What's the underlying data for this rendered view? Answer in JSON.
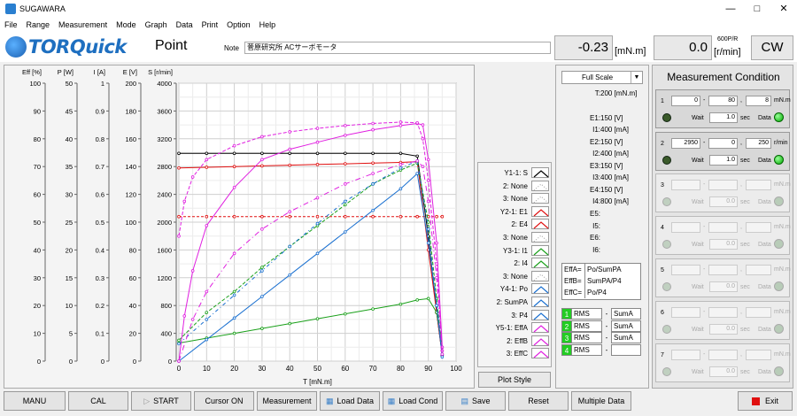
{
  "window": {
    "title": "SUGAWARA"
  },
  "menu": [
    "File",
    "Range",
    "Measurement",
    "Mode",
    "Graph",
    "Data",
    "Print",
    "Option",
    "Help"
  ],
  "header": {
    "logo_text": "TORQuick",
    "mode": "Point",
    "note_label": "Note",
    "note_value": "菅原研究所 ACサーボモータ",
    "torque_value": "-0.23",
    "torque_unit": "[mN.m]",
    "speed_value": "0.0",
    "speed_ppr": "600P/R",
    "speed_unit": "[r/min]",
    "direction": "CW"
  },
  "axes": {
    "labels": [
      "Eff [%]",
      "P [W]",
      "I [A]",
      "E [V]",
      "S [r/min]"
    ],
    "eff": [
      "100",
      "90",
      "80",
      "70",
      "60",
      "50",
      "40",
      "30",
      "20",
      "10",
      "0"
    ],
    "p": [
      "50",
      "45",
      "40",
      "35",
      "30",
      "25",
      "20",
      "15",
      "10",
      "5",
      "0"
    ],
    "i": [
      "1",
      "0.9",
      "0.8",
      "0.7",
      "0.6",
      "0.5",
      "0.4",
      "0.3",
      "0.2",
      "0.1",
      "0"
    ],
    "e": [
      "200",
      "180",
      "160",
      "140",
      "120",
      "100",
      "80",
      "60",
      "40",
      "20",
      "0"
    ],
    "s": [
      "4000",
      "3600",
      "3200",
      "2800",
      "2400",
      "2000",
      "1600",
      "1200",
      "800",
      "400",
      "0"
    ],
    "x": [
      "0",
      "10",
      "20",
      "30",
      "40",
      "50",
      "60",
      "70",
      "80",
      "90",
      "100"
    ],
    "x_label": "T [mN.m]"
  },
  "chart_data": {
    "type": "line",
    "x_label": "T [mN.m]",
    "xlim": [
      0,
      100
    ],
    "ylim_speed": [
      0,
      4000
    ],
    "grid": true,
    "series": [
      {
        "name": "Y1-1: S",
        "color": "#000000",
        "x": [
          0,
          10,
          20,
          30,
          40,
          50,
          60,
          70,
          80,
          86,
          90,
          93,
          95
        ],
        "y": [
          2990,
          2990,
          2990,
          2990,
          2990,
          2990,
          2990,
          2990,
          2990,
          2950,
          1800,
          700,
          80
        ]
      },
      {
        "name": "Y2-1: E1",
        "color": "#e01010",
        "x": [
          0,
          10,
          20,
          30,
          40,
          50,
          60,
          70,
          80,
          86,
          90,
          93,
          95
        ],
        "y": [
          2780,
          2790,
          2800,
          2810,
          2820,
          2830,
          2840,
          2850,
          2860,
          2870,
          1600,
          700,
          100
        ]
      },
      {
        "name": "Y2-2: E4",
        "color": "#e01010",
        "x": [
          0,
          10,
          20,
          30,
          40,
          50,
          60,
          70,
          80,
          86,
          90,
          93,
          95
        ],
        "y": [
          2080,
          2080,
          2080,
          2080,
          2080,
          2080,
          2080,
          2080,
          2080,
          2080,
          2080,
          2080,
          2080
        ]
      },
      {
        "name": "Y3-1: I1",
        "color": "#1aa01a",
        "x": [
          0,
          10,
          20,
          30,
          40,
          50,
          60,
          70,
          80,
          86,
          90,
          93,
          95
        ],
        "y": [
          260,
          330,
          400,
          470,
          540,
          610,
          680,
          750,
          820,
          880,
          900,
          700,
          200
        ]
      },
      {
        "name": "Y3-2: I4",
        "color": "#1aa01a",
        "x": [
          0,
          10,
          20,
          30,
          40,
          50,
          60,
          70,
          80,
          86,
          90,
          93,
          95
        ],
        "y": [
          300,
          700,
          1000,
          1350,
          1650,
          1950,
          2250,
          2550,
          2750,
          2850,
          2000,
          900,
          150
        ]
      },
      {
        "name": "Y4-1: Po",
        "color": "#1a70d0",
        "x": [
          0,
          10,
          20,
          30,
          40,
          50,
          60,
          70,
          80,
          86,
          90,
          93,
          95
        ],
        "y": [
          0,
          310,
          620,
          930,
          1240,
          1550,
          1860,
          2170,
          2480,
          2700,
          1700,
          800,
          60
        ]
      },
      {
        "name": "Y4-2: SumPA",
        "color": "#1a70d0",
        "x": [
          0,
          10,
          20,
          30,
          40,
          50,
          60,
          70,
          80,
          86,
          90,
          93,
          95
        ],
        "y": [
          250,
          600,
          950,
          1300,
          1650,
          1980,
          2300,
          2550,
          2780,
          2880,
          1900,
          800,
          100
        ]
      },
      {
        "name": "Y5-1: EffA",
        "color": "#e020e0",
        "x": [
          0,
          2,
          5,
          10,
          20,
          30,
          40,
          50,
          60,
          70,
          80,
          86,
          88,
          90,
          93,
          95
        ],
        "y": [
          0,
          650,
          1300,
          1950,
          2500,
          2900,
          3050,
          3150,
          3250,
          3330,
          3390,
          3420,
          3400,
          2900,
          1700,
          200
        ]
      },
      {
        "name": "Y5-2: EffB",
        "color": "#e020e0",
        "x": [
          0,
          2,
          5,
          10,
          20,
          30,
          40,
          50,
          60,
          70,
          80,
          86,
          88,
          90,
          93,
          95
        ],
        "y": [
          1800,
          2300,
          2650,
          2900,
          3100,
          3230,
          3300,
          3350,
          3390,
          3420,
          3440,
          3430,
          3200,
          2600,
          1400,
          150
        ]
      },
      {
        "name": "Y5-3: EffC",
        "color": "#e020e0",
        "x": [
          0,
          5,
          10,
          20,
          30,
          40,
          50,
          60,
          70,
          80,
          86,
          88,
          90,
          93,
          95
        ],
        "y": [
          0,
          600,
          1000,
          1550,
          1900,
          2150,
          2350,
          2550,
          2700,
          2830,
          2880,
          2800,
          2300,
          1200,
          100
        ]
      }
    ]
  },
  "legend": [
    {
      "label": "Y1-1: S",
      "color": "#000000",
      "on": true
    },
    {
      "label": "2: None",
      "color": "#aaaaaa",
      "on": false
    },
    {
      "label": "3: None",
      "color": "#aaaaaa",
      "on": false
    },
    {
      "label": "Y2-1: E1",
      "color": "#e01010",
      "on": true
    },
    {
      "label": "2: E4",
      "color": "#e01010",
      "on": true
    },
    {
      "label": "3: None",
      "color": "#aaaaaa",
      "on": false
    },
    {
      "label": "Y3-1: I1",
      "color": "#1aa01a",
      "on": true
    },
    {
      "label": "2: I4",
      "color": "#1aa01a",
      "on": true
    },
    {
      "label": "3: None",
      "color": "#aaaaaa",
      "on": false
    },
    {
      "label": "Y4-1: Po",
      "color": "#1a70d0",
      "on": true
    },
    {
      "label": "2: SumPA",
      "color": "#1a70d0",
      "on": true
    },
    {
      "label": "3: P4",
      "color": "#1a70d0",
      "on": true
    },
    {
      "label": "Y5-1: EffA",
      "color": "#e020e0",
      "on": true
    },
    {
      "label": "2: EffB",
      "color": "#e020e0",
      "on": true
    },
    {
      "label": "3: EffC",
      "color": "#e020e0",
      "on": true
    }
  ],
  "plot_style_label": "Plot Style",
  "scale": {
    "selected": "Full Scale"
  },
  "levels": [
    {
      "k": "T:",
      "v": "200 [mN.m]"
    },
    {
      "k": "E1:",
      "v": "150 [V]"
    },
    {
      "k": "I1:",
      "v": "400 [mA]"
    },
    {
      "k": "E2:",
      "v": "150 [V]"
    },
    {
      "k": "I2:",
      "v": "400 [mA]"
    },
    {
      "k": "E3:",
      "v": "150 [V]"
    },
    {
      "k": "I3:",
      "v": "400 [mA]"
    },
    {
      "k": "E4:",
      "v": "150 [V]"
    },
    {
      "k": "I4:",
      "v": "800 [mA]"
    },
    {
      "k": "E5:",
      "v": ""
    },
    {
      "k": "I5:",
      "v": ""
    },
    {
      "k": "E6:",
      "v": ""
    },
    {
      "k": "I6:",
      "v": ""
    }
  ],
  "eff_defs": [
    {
      "a": "EffA=",
      "b": "Po/SumPA"
    },
    {
      "a": "EffB=",
      "b": "SumPA/P4"
    },
    {
      "a": "EffC=",
      "b": "Po/P4"
    }
  ],
  "combos": [
    {
      "n": "1",
      "r": "RMS",
      "s": "SumA"
    },
    {
      "n": "2",
      "r": "RMS",
      "s": "SumA"
    },
    {
      "n": "3",
      "r": "RMS",
      "s": "SumA"
    },
    {
      "n": "4",
      "r": "RMS",
      "s": ""
    }
  ],
  "mc": {
    "title": "Measurement Condition",
    "rows": [
      {
        "idx": "1",
        "a": "0",
        "b": "80",
        "c": "8",
        "unit": "mN.m",
        "wait": "1.0",
        "active": true
      },
      {
        "idx": "2",
        "a": "2950",
        "b": "0",
        "c": "250",
        "unit": "r/min",
        "wait": "1.0",
        "active": true
      },
      {
        "idx": "3",
        "a": "",
        "b": "",
        "c": "",
        "unit": "mN.m",
        "wait": "0.0",
        "active": false
      },
      {
        "idx": "4",
        "a": "",
        "b": "",
        "c": "",
        "unit": "mN.m",
        "wait": "0.0",
        "active": false
      },
      {
        "idx": "5",
        "a": "",
        "b": "",
        "c": "",
        "unit": "mN.m",
        "wait": "0.0",
        "active": false
      },
      {
        "idx": "6",
        "a": "",
        "b": "",
        "c": "",
        "unit": "mN.m",
        "wait": "0.0",
        "active": false
      },
      {
        "idx": "7",
        "a": "",
        "b": "",
        "c": "",
        "unit": "mN.m",
        "wait": "0.0",
        "active": false
      }
    ],
    "wait_label": "Wait",
    "sec_label": "sec",
    "data_label": "Data"
  },
  "buttons": {
    "manu": "MANU",
    "cal": "CAL",
    "start": "START",
    "cursor": "Cursor ON",
    "measurement": "Measurement",
    "load_data": "Load Data",
    "load_cond": "Load Cond",
    "save": "Save",
    "reset": "Reset",
    "multiple": "Multiple Data",
    "exit": "Exit"
  }
}
